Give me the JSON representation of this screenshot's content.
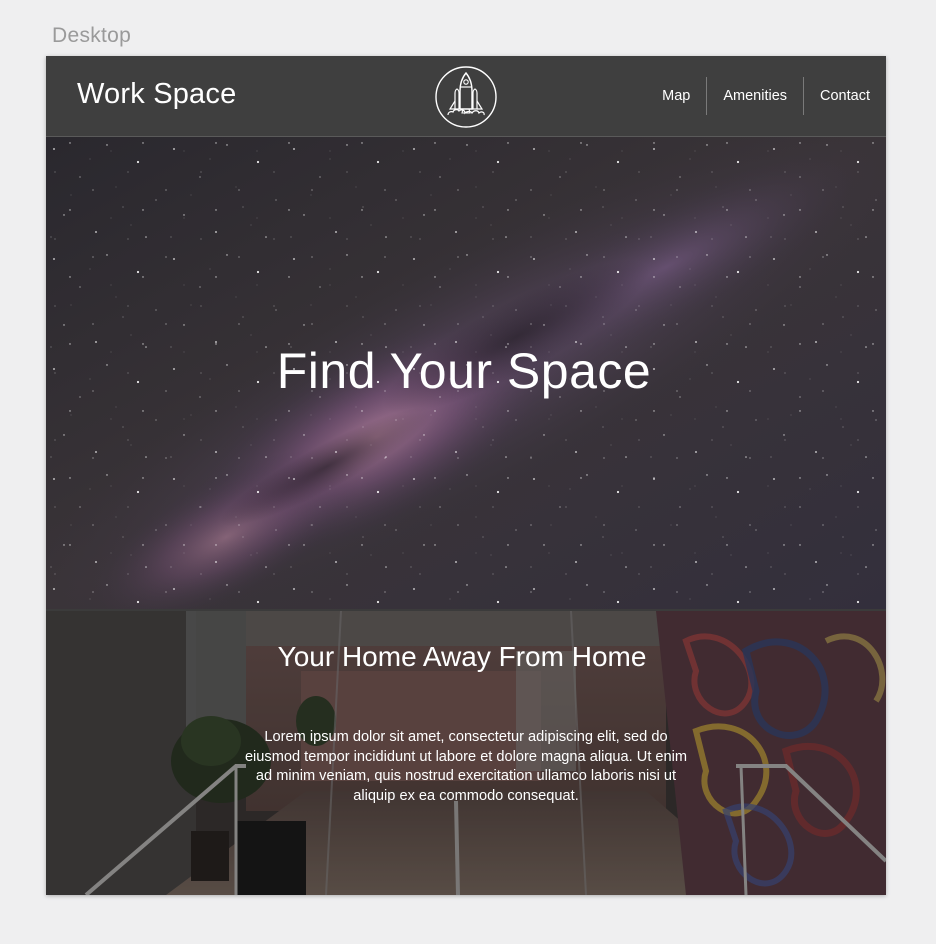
{
  "artboard": {
    "label": "Desktop"
  },
  "header": {
    "brand": "Work Space",
    "logo_icon": "rocket-shuttle-icon",
    "nav": [
      {
        "label": "Map"
      },
      {
        "label": "Amenities"
      },
      {
        "label": "Contact"
      }
    ]
  },
  "hero": {
    "title": "Find Your Space",
    "background": "milky-way-night-sky"
  },
  "section": {
    "title": "Your Home Away From Home",
    "body": "Lorem ipsum dolor sit amet, consectetur adipiscing elit, sed do eiusmod tempor incididunt ut labore et dolore magna aliqua. Ut enim ad minim veniam, quis nostrud exercitation ullamco laboris nisi ut aliquip ex ea commodo consequat.",
    "background": "office-interior-photo"
  },
  "colors": {
    "header_bg": "#3f3f3f",
    "text": "#ffffff",
    "canvas_bg": "#efeff0"
  }
}
